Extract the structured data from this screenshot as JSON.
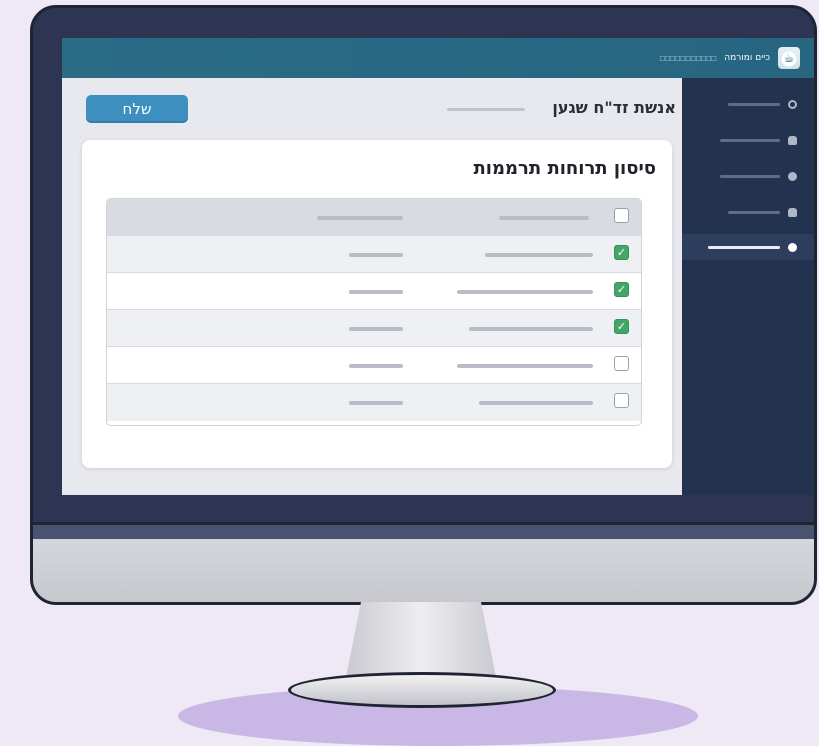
{
  "app": {
    "brand_name": "כיים ומורמה",
    "brand_sub": "□□□□□□□□□□□",
    "logo_icon": "cup-icon"
  },
  "toolbar": {
    "send_label": "שלח"
  },
  "page": {
    "title": "אנשת זד\"ח שגען"
  },
  "card": {
    "title": "סיסון תרוחות תרממות"
  },
  "sidebar": {
    "items": [
      {
        "icon": "circle-outline-icon",
        "active": false
      },
      {
        "icon": "lock-icon",
        "active": false
      },
      {
        "icon": "dot-icon",
        "active": false
      },
      {
        "icon": "lock-icon",
        "active": false
      },
      {
        "icon": "gear-icon",
        "active": true
      }
    ]
  },
  "table": {
    "header_checked": false,
    "rows": [
      {
        "checked": true
      },
      {
        "checked": true
      },
      {
        "checked": true
      },
      {
        "checked": false
      },
      {
        "checked": false
      }
    ]
  },
  "colors": {
    "topbar": "#2a6b86",
    "sidebar": "#23324f",
    "accent_button": "#3d8fc0",
    "check_on": "#43a867"
  }
}
